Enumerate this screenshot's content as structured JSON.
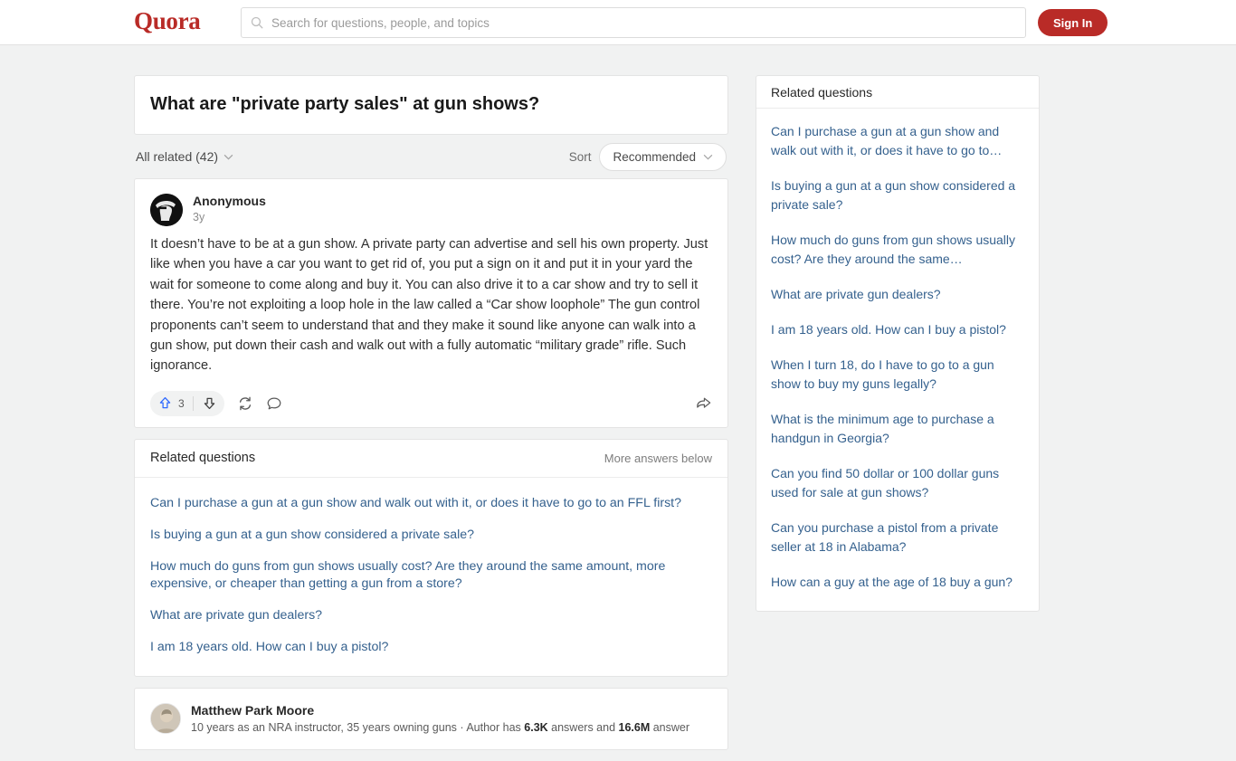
{
  "header": {
    "logo": "Quora",
    "search_placeholder": "Search for questions, people, and topics",
    "search_value": "",
    "signin_label": "Sign In",
    "search_icon": "search-icon"
  },
  "question": {
    "title": "What are \"private party sales\" at gun shows?"
  },
  "filter": {
    "all_related_label": "All related (42)",
    "sort_label": "Sort",
    "sort_value": "Recommended"
  },
  "answers": [
    {
      "author": "Anonymous",
      "time": "3y",
      "avatar": "anonymous-avatar",
      "body": "It doesn’t have to be at a gun show. A private party can advertise and sell his own property. Just like when you have a car you want to get rid of, you put a sign on it and put it in your yard the wait for someone to come along and buy it. You can also drive it to a car show and try to sell it there. You’re not exploiting a loop hole in the law called a “Car show loophole” The gun control proponents can’t seem to understand that and they make it sound like anyone can walk into a gun show, put down their cash and walk out with a fully automatic “military grade” rifle. Such ignorance.",
      "upvote_count": "3"
    }
  ],
  "second_answer": {
    "author": "Matthew Park Moore",
    "avatar": "profile-photo-avatar",
    "credentials_prefix": "10 years as an NRA instructor, 35 years owning guns · Author has ",
    "credentials_answers": "6.3K",
    "credentials_mid": " answers and ",
    "credentials_views": "16.6M",
    "credentials_suffix": " answer"
  },
  "related_block": {
    "title": "Related questions",
    "more_label": "More answers below",
    "items": [
      "Can I purchase a gun at a gun show and walk out with it, or does it have to go to an FFL first?",
      "Is buying a gun at a gun show considered a private sale?",
      "How much do guns from gun shows usually cost? Are they around the same amount, more expensive, or cheaper than getting a gun from a store?",
      "What are private gun dealers?",
      "I am 18 years old. How can I buy a pistol?"
    ]
  },
  "sidebar": {
    "title": "Related questions",
    "items": [
      "Can I purchase a gun at a gun show and walk out with it, or does it have to go to…",
      "Is buying a gun at a gun show considered a private sale?",
      "How much do guns from gun shows usually cost? Are they around the same…",
      "What are private gun dealers?",
      "I am 18 years old. How can I buy a pistol?",
      "When I turn 18, do I have to go to a gun show to buy my guns legally?",
      "What is the minimum age to purchase a handgun in Georgia?",
      "Can you find 50 dollar or 100 dollar guns used for sale at gun shows?",
      "Can you purchase a pistol from a private seller at 18 in Alabama?",
      "How can a guy at the age of 18 buy a gun?"
    ]
  },
  "icons": {
    "upvote": "upvote-arrow-icon",
    "downvote": "downvote-arrow-icon",
    "repost": "repost-icon",
    "comment": "comment-icon",
    "share": "share-icon",
    "chevron": "chevron-down-icon"
  },
  "colors": {
    "brand": "#b92b27",
    "link": "#35618e",
    "page_bg": "#f1f2f2",
    "upvote_blue": "#2e69ff"
  }
}
